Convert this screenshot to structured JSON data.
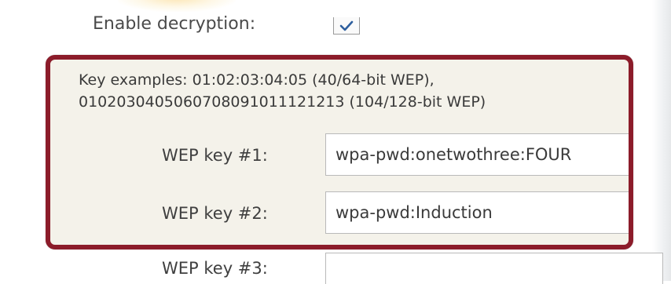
{
  "decryption": {
    "enable_label": "Enable decryption:",
    "checked": true
  },
  "key_examples": {
    "line1": "Key examples: 01:02:03:04:05 (40/64-bit WEP),",
    "line2": "0102030405060708091011121213 (104/128-bit WEP)"
  },
  "wep_keys": [
    {
      "label": "WEP key #1:",
      "value": "wpa-pwd:onetwothree:FOUR"
    },
    {
      "label": "WEP key #2:",
      "value": "wpa-pwd:Induction"
    },
    {
      "label": "WEP key #3:",
      "value": ""
    }
  ],
  "colors": {
    "highlight_border": "#8c1c2a",
    "highlight_fill": "#f4f2ea"
  }
}
